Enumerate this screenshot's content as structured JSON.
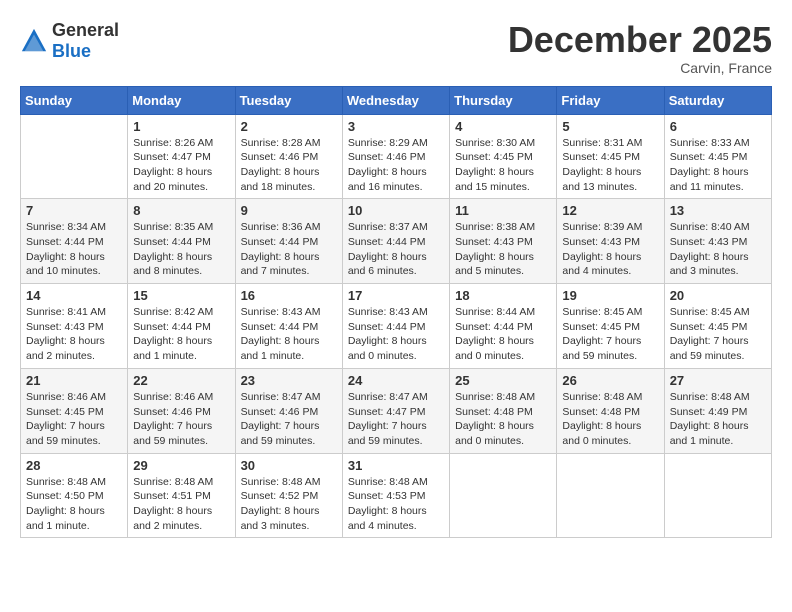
{
  "logo": {
    "text_general": "General",
    "text_blue": "Blue"
  },
  "title": "December 2025",
  "location": "Carvin, France",
  "days_of_week": [
    "Sunday",
    "Monday",
    "Tuesday",
    "Wednesday",
    "Thursday",
    "Friday",
    "Saturday"
  ],
  "weeks": [
    [
      {
        "day": "",
        "sunrise": "",
        "sunset": "",
        "daylight": ""
      },
      {
        "day": "1",
        "sunrise": "Sunrise: 8:26 AM",
        "sunset": "Sunset: 4:47 PM",
        "daylight": "Daylight: 8 hours and 20 minutes."
      },
      {
        "day": "2",
        "sunrise": "Sunrise: 8:28 AM",
        "sunset": "Sunset: 4:46 PM",
        "daylight": "Daylight: 8 hours and 18 minutes."
      },
      {
        "day": "3",
        "sunrise": "Sunrise: 8:29 AM",
        "sunset": "Sunset: 4:46 PM",
        "daylight": "Daylight: 8 hours and 16 minutes."
      },
      {
        "day": "4",
        "sunrise": "Sunrise: 8:30 AM",
        "sunset": "Sunset: 4:45 PM",
        "daylight": "Daylight: 8 hours and 15 minutes."
      },
      {
        "day": "5",
        "sunrise": "Sunrise: 8:31 AM",
        "sunset": "Sunset: 4:45 PM",
        "daylight": "Daylight: 8 hours and 13 minutes."
      },
      {
        "day": "6",
        "sunrise": "Sunrise: 8:33 AM",
        "sunset": "Sunset: 4:45 PM",
        "daylight": "Daylight: 8 hours and 11 minutes."
      }
    ],
    [
      {
        "day": "7",
        "sunrise": "Sunrise: 8:34 AM",
        "sunset": "Sunset: 4:44 PM",
        "daylight": "Daylight: 8 hours and 10 minutes."
      },
      {
        "day": "8",
        "sunrise": "Sunrise: 8:35 AM",
        "sunset": "Sunset: 4:44 PM",
        "daylight": "Daylight: 8 hours and 8 minutes."
      },
      {
        "day": "9",
        "sunrise": "Sunrise: 8:36 AM",
        "sunset": "Sunset: 4:44 PM",
        "daylight": "Daylight: 8 hours and 7 minutes."
      },
      {
        "day": "10",
        "sunrise": "Sunrise: 8:37 AM",
        "sunset": "Sunset: 4:44 PM",
        "daylight": "Daylight: 8 hours and 6 minutes."
      },
      {
        "day": "11",
        "sunrise": "Sunrise: 8:38 AM",
        "sunset": "Sunset: 4:43 PM",
        "daylight": "Daylight: 8 hours and 5 minutes."
      },
      {
        "day": "12",
        "sunrise": "Sunrise: 8:39 AM",
        "sunset": "Sunset: 4:43 PM",
        "daylight": "Daylight: 8 hours and 4 minutes."
      },
      {
        "day": "13",
        "sunrise": "Sunrise: 8:40 AM",
        "sunset": "Sunset: 4:43 PM",
        "daylight": "Daylight: 8 hours and 3 minutes."
      }
    ],
    [
      {
        "day": "14",
        "sunrise": "Sunrise: 8:41 AM",
        "sunset": "Sunset: 4:43 PM",
        "daylight": "Daylight: 8 hours and 2 minutes."
      },
      {
        "day": "15",
        "sunrise": "Sunrise: 8:42 AM",
        "sunset": "Sunset: 4:44 PM",
        "daylight": "Daylight: 8 hours and 1 minute."
      },
      {
        "day": "16",
        "sunrise": "Sunrise: 8:43 AM",
        "sunset": "Sunset: 4:44 PM",
        "daylight": "Daylight: 8 hours and 1 minute."
      },
      {
        "day": "17",
        "sunrise": "Sunrise: 8:43 AM",
        "sunset": "Sunset: 4:44 PM",
        "daylight": "Daylight: 8 hours and 0 minutes."
      },
      {
        "day": "18",
        "sunrise": "Sunrise: 8:44 AM",
        "sunset": "Sunset: 4:44 PM",
        "daylight": "Daylight: 8 hours and 0 minutes."
      },
      {
        "day": "19",
        "sunrise": "Sunrise: 8:45 AM",
        "sunset": "Sunset: 4:45 PM",
        "daylight": "Daylight: 7 hours and 59 minutes."
      },
      {
        "day": "20",
        "sunrise": "Sunrise: 8:45 AM",
        "sunset": "Sunset: 4:45 PM",
        "daylight": "Daylight: 7 hours and 59 minutes."
      }
    ],
    [
      {
        "day": "21",
        "sunrise": "Sunrise: 8:46 AM",
        "sunset": "Sunset: 4:45 PM",
        "daylight": "Daylight: 7 hours and 59 minutes."
      },
      {
        "day": "22",
        "sunrise": "Sunrise: 8:46 AM",
        "sunset": "Sunset: 4:46 PM",
        "daylight": "Daylight: 7 hours and 59 minutes."
      },
      {
        "day": "23",
        "sunrise": "Sunrise: 8:47 AM",
        "sunset": "Sunset: 4:46 PM",
        "daylight": "Daylight: 7 hours and 59 minutes."
      },
      {
        "day": "24",
        "sunrise": "Sunrise: 8:47 AM",
        "sunset": "Sunset: 4:47 PM",
        "daylight": "Daylight: 7 hours and 59 minutes."
      },
      {
        "day": "25",
        "sunrise": "Sunrise: 8:48 AM",
        "sunset": "Sunset: 4:48 PM",
        "daylight": "Daylight: 8 hours and 0 minutes."
      },
      {
        "day": "26",
        "sunrise": "Sunrise: 8:48 AM",
        "sunset": "Sunset: 4:48 PM",
        "daylight": "Daylight: 8 hours and 0 minutes."
      },
      {
        "day": "27",
        "sunrise": "Sunrise: 8:48 AM",
        "sunset": "Sunset: 4:49 PM",
        "daylight": "Daylight: 8 hours and 1 minute."
      }
    ],
    [
      {
        "day": "28",
        "sunrise": "Sunrise: 8:48 AM",
        "sunset": "Sunset: 4:50 PM",
        "daylight": "Daylight: 8 hours and 1 minute."
      },
      {
        "day": "29",
        "sunrise": "Sunrise: 8:48 AM",
        "sunset": "Sunset: 4:51 PM",
        "daylight": "Daylight: 8 hours and 2 minutes."
      },
      {
        "day": "30",
        "sunrise": "Sunrise: 8:48 AM",
        "sunset": "Sunset: 4:52 PM",
        "daylight": "Daylight: 8 hours and 3 minutes."
      },
      {
        "day": "31",
        "sunrise": "Sunrise: 8:48 AM",
        "sunset": "Sunset: 4:53 PM",
        "daylight": "Daylight: 8 hours and 4 minutes."
      },
      {
        "day": "",
        "sunrise": "",
        "sunset": "",
        "daylight": ""
      },
      {
        "day": "",
        "sunrise": "",
        "sunset": "",
        "daylight": ""
      },
      {
        "day": "",
        "sunrise": "",
        "sunset": "",
        "daylight": ""
      }
    ]
  ]
}
